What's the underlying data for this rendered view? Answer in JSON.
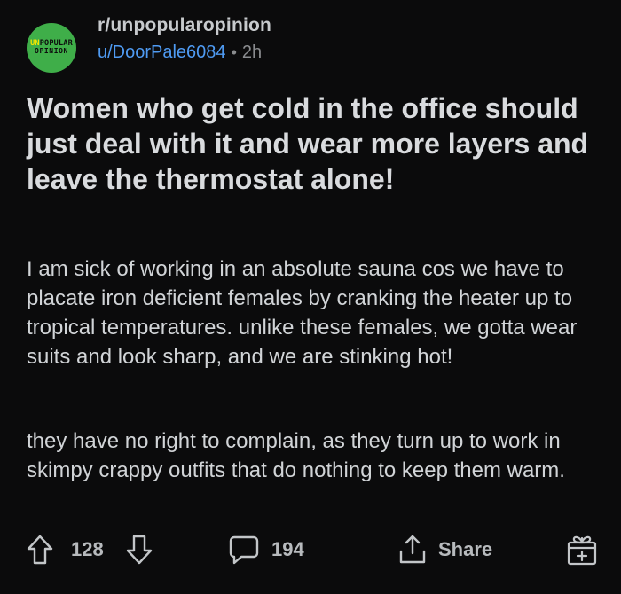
{
  "post": {
    "subreddit": "r/unpopularopinion",
    "author": "u/DoorPale6084",
    "separator": "•",
    "age": "2h",
    "avatar": {
      "line1_prefix": "UN",
      "line1_rest": "POPULAR",
      "line2": "OPINION",
      "bg": "#3fae49",
      "prefix_color": "#f3e600"
    },
    "title": "Women who get cold in the office should just deal with it and wear more layers and leave the thermostat alone!",
    "paragraphs": [
      "I am sick of working in an absolute sauna cos we have to placate iron deficient females by cranking the heater up to tropical temperatures. unlike these females, we gotta wear suits and look sharp, and we are stinking hot!",
      "they have no right to complain, as they turn up to work in skimpy crappy outfits that do nothing to keep them warm."
    ]
  },
  "actions": {
    "upvote_icon": "arrow-up-icon",
    "votes": "128",
    "downvote_icon": "arrow-down-icon",
    "comment_icon": "comment-bubble-icon",
    "comments": "194",
    "share_icon": "share-icon",
    "share_label": "Share",
    "award_icon": "gift-award-icon"
  },
  "colors": {
    "background": "#0b0b0c",
    "username": "#4f9bf3",
    "text": "#d7dadc",
    "muted": "#8a8c8f"
  }
}
